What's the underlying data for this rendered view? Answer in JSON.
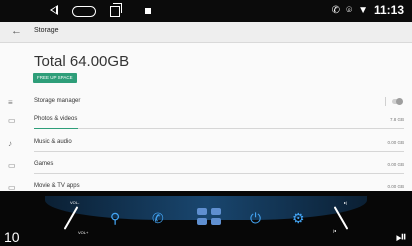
{
  "status_bar": {
    "time": "11:13",
    "icons": [
      "back-triangle-icon",
      "home-pill-icon",
      "recents-icon",
      "notification-square-icon",
      "phone-icon",
      "location-icon",
      "wifi-icon"
    ]
  },
  "app_bar": {
    "back_icon": "arrow-left-icon",
    "title": "Storage"
  },
  "storage": {
    "total_label": "Total",
    "total_value": "64.00GB",
    "free_up_label": "FREE UP SPACE"
  },
  "rows": [
    {
      "label": "Storage manager",
      "icon": "storage-list-icon",
      "toggle": true
    },
    {
      "label": "Photos & videos",
      "icon": "photos-icon",
      "size": "7.8 GB",
      "fill": 0.12
    },
    {
      "label": "Music & audio",
      "icon": "music-note-icon",
      "size": "0.00 GB",
      "fill": 0
    },
    {
      "label": "Games",
      "icon": "gamepad-icon",
      "size": "0.00 GB",
      "fill": 0
    },
    {
      "label": "Movie & TV apps",
      "icon": "movie-icon",
      "size": "0.00 GB",
      "fill": 0
    }
  ],
  "dock": {
    "vol_minus": "VOL-",
    "vol_plus": "VOL+",
    "number": "10",
    "icons": [
      "location-pin-icon",
      "phone-icon",
      "apps-grid-icon",
      "power-icon",
      "settings-gear-icon"
    ],
    "media_icon": "play-pause-icon"
  },
  "colors": {
    "accent_green": "#2e9e79",
    "dock_blue": "#43a4f3",
    "status_bg": "#0b0b0b"
  }
}
